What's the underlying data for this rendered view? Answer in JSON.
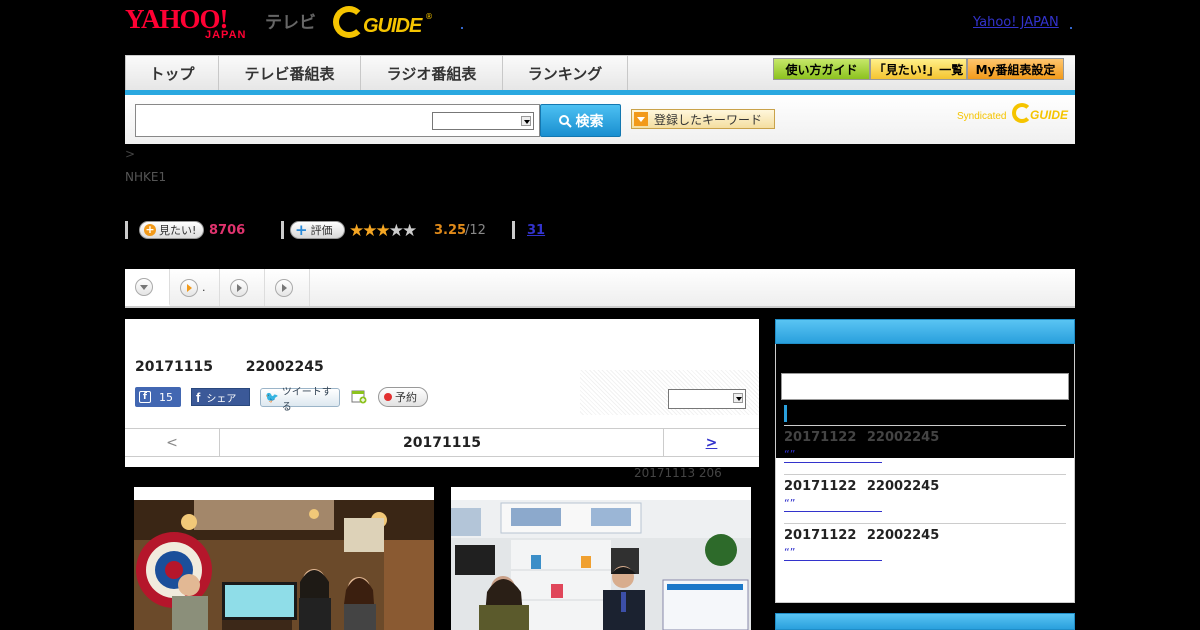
{
  "header": {
    "yahoo_logo_text": "YAHOO!",
    "yahoo_logo_sub": "JAPAN",
    "tv_text": "テレビ",
    "gguide_logo_text": "GUIDE",
    "yahoo_japan_link": "Yahoo! JAPAN"
  },
  "nav": {
    "tabs": [
      {
        "label": "トップ"
      },
      {
        "label": "テレビ番組表"
      },
      {
        "label": "ラジオ番組表"
      },
      {
        "label": "ランキング"
      }
    ],
    "guide_buttons": [
      {
        "label": "使い方ガイド",
        "color": "#9acd32"
      },
      {
        "label": "「見たい!」一覧",
        "color": "#f4c430"
      },
      {
        "label": "My番組表設定",
        "color": "#f29a1a"
      }
    ],
    "accent_color": "#2aa8e0"
  },
  "search": {
    "input_value": "",
    "select_value": "",
    "button_label": "検索",
    "keyword_button_label": "登録したキーワード",
    "syndicated_text": "Syndicated",
    "syndicated_logo_text": "GUIDE"
  },
  "program": {
    "breadcrumb": ">",
    "channel": "NHKE1",
    "want_label": "見たい!",
    "want_count": "8706",
    "rate_label": "評価",
    "stars_filled": 3,
    "stars_total": 5,
    "rating": "3.25",
    "rating_count": "/12",
    "comment_count": "31"
  },
  "tabs": {
    "items": [
      {
        "icon": "chevron-down-icon",
        "label": ""
      },
      {
        "icon": "play-orange-icon",
        "label": "."
      },
      {
        "icon": "play-icon",
        "label": ""
      },
      {
        "icon": "play-icon",
        "label": ""
      }
    ]
  },
  "main": {
    "air_date": "20171115 22002245",
    "fb_like_count": "15",
    "fb_share_label": "シェア",
    "tweet_label": "ツイートする",
    "reserve_label": "予約",
    "select_value": "",
    "date_nav": {
      "prev": "<",
      "current": "20171115",
      "next": ">"
    },
    "updated_text": "20171113 206"
  },
  "sidebar": {
    "search_value": "",
    "items": [
      {
        "title": "20171122 22002245",
        "link": "“”"
      },
      {
        "title": "20171122 22002245",
        "link": "“”"
      },
      {
        "title": "20171122 22002245",
        "link": "“”"
      }
    ]
  }
}
